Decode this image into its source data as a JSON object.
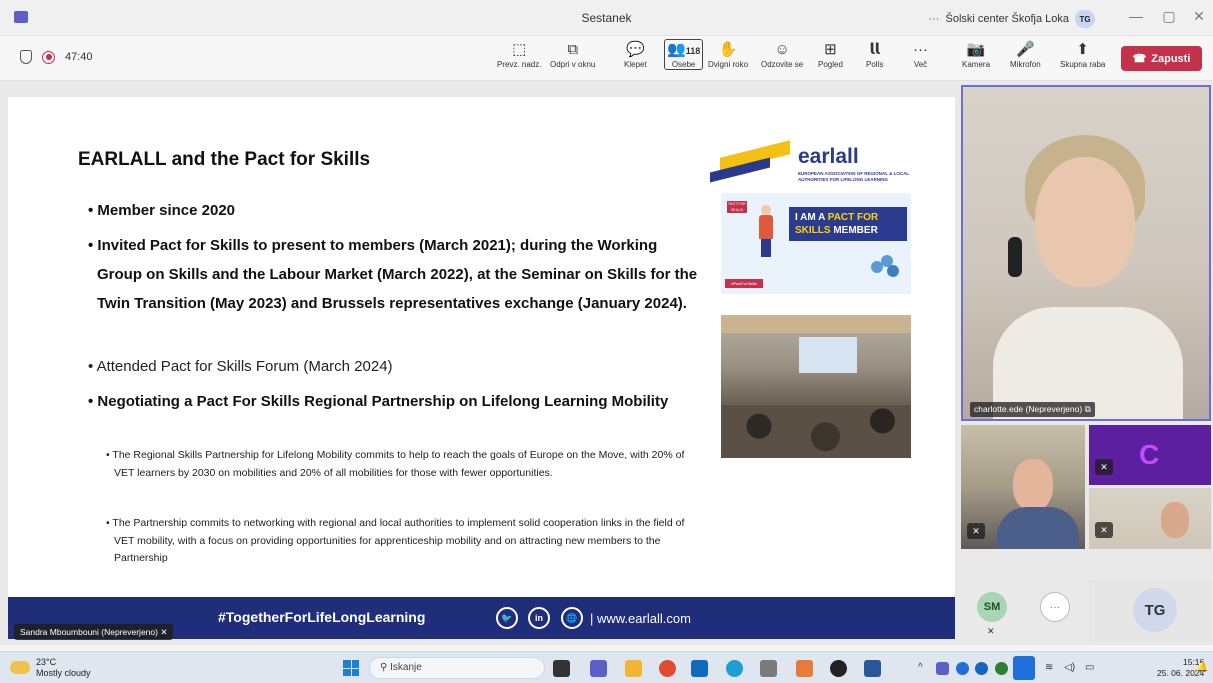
{
  "window": {
    "title": "Sestanek",
    "org_dots": "···",
    "org_name": "Šolski center Škofja Loka",
    "org_badge": "TG",
    "minimize": "—",
    "restore": "▢",
    "close": "✕"
  },
  "toolbar": {
    "timer": "47:40",
    "items": [
      {
        "label": "Prevz. nadz.",
        "icon": "⬚"
      },
      {
        "label": "Odpri v oknu",
        "icon": "⧉"
      },
      {
        "label": "Klepet",
        "icon": "💬"
      },
      {
        "label": "Osebe",
        "icon": "👥",
        "count": "118"
      },
      {
        "label": "Dvigni roko",
        "icon": "✋"
      },
      {
        "label": "Odzovite se",
        "icon": "☺"
      },
      {
        "label": "Pogled",
        "icon": "⊞"
      },
      {
        "label": "Polls",
        "icon": "𝗹𝗹"
      },
      {
        "label": "Več",
        "icon": "···"
      },
      {
        "label": "Kamera",
        "icon": "📷"
      },
      {
        "label": "Mikrofon",
        "icon": "🎤"
      },
      {
        "label": "Skupna raba",
        "icon": "⬆"
      }
    ],
    "leave_label": "Zapusti"
  },
  "slide": {
    "title": "EARLALL and the Pact for Skills",
    "bullets": [
      "• Member since 2020",
      "• Invited Pact for Skills to present to members (March 2021); during the Working Group on Skills and the Labour Market (March 2022), at the Seminar on Skills for the Twin Transition (May 2023) and Brussels representatives exchange (January 2024).",
      "• Attended Pact for Skills Forum (March 2024)",
      "• Negotiating a Pact For Skills Regional Partnership on Lifelong Learning Mobility"
    ],
    "sub_bullets": [
      "• The Regional Skills Partnership for Lifelong Mobility commits to help to reach the goals of Europe on the Move, with 20% of VET learners by 2030 on mobilities and 20% of all mobilities for those with fewer opportunities.",
      "• The Partnership commits to networking with regional and local authorities to implement solid cooperation links in the field of VET mobility, with a focus on providing opportunities for apprenticeship mobility and on attracting new members to the Partnership"
    ],
    "logo_name": "earlall",
    "logo_subtitle": "EUROPEAN ASSOCIATION OF REGIONAL & LOCAL AUTHORITIES FOR LIFELONG LEARNING",
    "pact_mini": "PACT FOR SKILLS",
    "pact_banner_1": "I AM A ",
    "pact_banner_hl": "PACT FOR",
    "pact_banner_2": "SKILLS",
    "pact_banner_3": " MEMBER",
    "pact_tag": "#PactForSkills",
    "footer_hashtag": "#TogetherForLifeLongLearning",
    "footer_social": [
      "🐦",
      "in",
      "🌐"
    ],
    "footer_url": "| www.earlall.com"
  },
  "presenter_label": "Sandra Mboumbouni (Nepreverjeno)",
  "participants": {
    "main_label": "charlotte.ede (Nepreverjeno)",
    "sm_initials": "SM",
    "more": "···",
    "tg_initials": "TG"
  },
  "taskbar": {
    "temperature": "23°C",
    "weather": "Mostly cloudy",
    "search_placeholder": "Iskanje",
    "time": "15:16",
    "date": "25. 06. 2024"
  },
  "colors": {
    "accent": "#5b5fc7",
    "leave": "#c4314b",
    "slide_footer": "#1f2d7a",
    "earlall_blue": "#2a3a8f",
    "earlall_yellow": "#f3c013"
  }
}
